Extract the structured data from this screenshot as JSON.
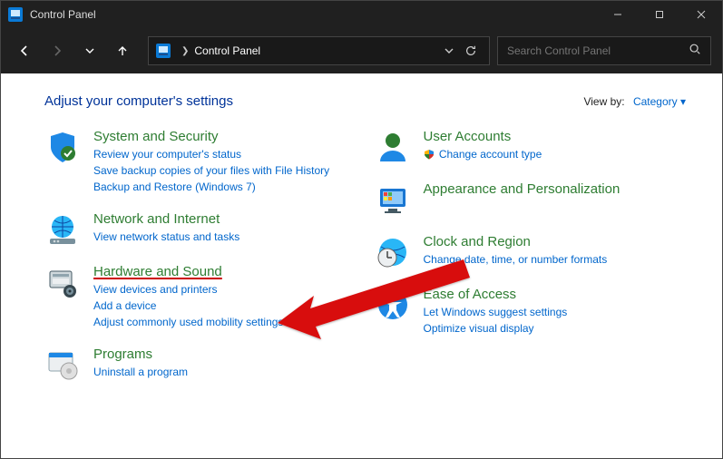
{
  "window": {
    "title": "Control Panel"
  },
  "addressbar": {
    "crumb": "Control Panel"
  },
  "search": {
    "placeholder": "Search Control Panel"
  },
  "heading": "Adjust your computer's settings",
  "viewby": {
    "label": "View by:",
    "value": "Category"
  },
  "left_categories": [
    {
      "id": "system-security",
      "title": "System and Security",
      "links": [
        "Review your computer's status",
        "Save backup copies of your files with File History",
        "Backup and Restore (Windows 7)"
      ]
    },
    {
      "id": "network-internet",
      "title": "Network and Internet",
      "links": [
        "View network status and tasks"
      ]
    },
    {
      "id": "hardware-sound",
      "title": "Hardware and Sound",
      "highlight": true,
      "links": [
        "View devices and printers",
        "Add a device",
        "Adjust commonly used mobility settings"
      ]
    },
    {
      "id": "programs",
      "title": "Programs",
      "links": [
        "Uninstall a program"
      ]
    }
  ],
  "right_categories": [
    {
      "id": "user-accounts",
      "title": "User Accounts",
      "links": [
        {
          "text": "Change account type",
          "shield": true
        }
      ]
    },
    {
      "id": "appearance",
      "title": "Appearance and Personalization",
      "links": []
    },
    {
      "id": "clock-region",
      "title": "Clock and Region",
      "links": [
        "Change date, time, or number formats"
      ]
    },
    {
      "id": "ease-of-access",
      "title": "Ease of Access",
      "links": [
        "Let Windows suggest settings",
        "Optimize visual display"
      ]
    }
  ]
}
